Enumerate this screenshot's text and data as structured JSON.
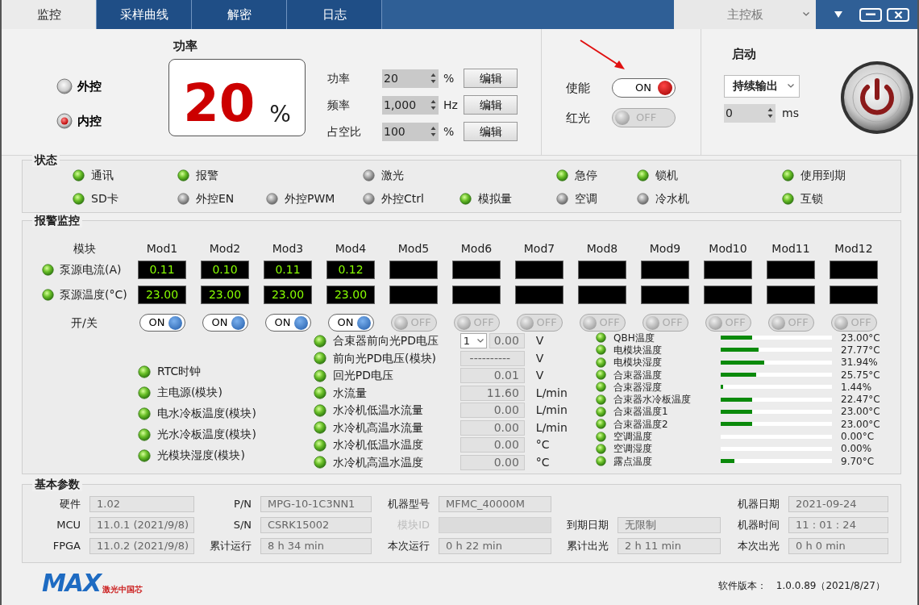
{
  "tabs": [
    {
      "label": "监控",
      "selected": true
    },
    {
      "label": "采样曲线",
      "selected": false
    },
    {
      "label": "解密",
      "selected": false
    },
    {
      "label": "日志",
      "selected": false
    }
  ],
  "board_select": {
    "value": "主控板"
  },
  "control_mode": [
    {
      "label": "外控",
      "selected": false
    },
    {
      "label": "内控",
      "selected": true
    }
  ],
  "power_display": {
    "title": "功率",
    "value": "20",
    "unit": "%"
  },
  "settings": [
    {
      "label": "功率",
      "value": "20",
      "unit": "%",
      "button": "编辑"
    },
    {
      "label": "频率",
      "value": "1,000",
      "unit": "Hz",
      "button": "编辑"
    },
    {
      "label": "占空比",
      "value": "100",
      "unit": "%",
      "button": "编辑"
    }
  ],
  "switches": [
    {
      "label": "使能",
      "on": true,
      "text": "ON"
    },
    {
      "label": "红光",
      "on": false,
      "text": "OFF"
    }
  ],
  "start": {
    "title": "启动",
    "mode": "持续输出",
    "delay": "0",
    "delay_unit": "ms"
  },
  "status": {
    "title": "状态",
    "rows": [
      [
        {
          "label": "通讯",
          "on": true
        },
        {
          "label": "报警",
          "on": true
        },
        "",
        {
          "label": "激光",
          "on": false
        },
        "",
        {
          "label": "急停",
          "on": true
        },
        {
          "label": "锁机",
          "on": true
        },
        "",
        {
          "label": "使用到期",
          "on": true
        }
      ],
      [
        {
          "label": "SD卡",
          "on": true
        },
        {
          "label": "外控EN",
          "on": false
        },
        {
          "label": "外控PWM",
          "on": false
        },
        {
          "label": "外控Ctrl",
          "on": false
        },
        {
          "label": "模拟量",
          "on": true
        },
        {
          "label": "空调",
          "on": false
        },
        {
          "label": "冷水机",
          "on": false
        },
        "",
        {
          "label": "互锁",
          "on": true
        }
      ]
    ]
  },
  "alarm": {
    "title": "报警监控",
    "module_header": "模块",
    "row_labels": [
      {
        "label": "泵源电流(A)",
        "on": true
      },
      {
        "label": "泵源温度(°C)",
        "on": true
      }
    ],
    "switch_label": "开/关",
    "modules": [
      {
        "name": "Mod1",
        "current": "0.11",
        "temp": "23.00",
        "on": true,
        "switch_text": "ON"
      },
      {
        "name": "Mod2",
        "current": "0.10",
        "temp": "23.00",
        "on": true,
        "switch_text": "ON"
      },
      {
        "name": "Mod3",
        "current": "0.11",
        "temp": "23.00",
        "on": true,
        "switch_text": "ON"
      },
      {
        "name": "Mod4",
        "current": "0.12",
        "temp": "23.00",
        "on": true,
        "switch_text": "ON"
      },
      {
        "name": "Mod5",
        "on": false,
        "switch_text": "OFF"
      },
      {
        "name": "Mod6",
        "on": false,
        "switch_text": "OFF"
      },
      {
        "name": "Mod7",
        "on": false,
        "switch_text": "OFF"
      },
      {
        "name": "Mod8",
        "on": false,
        "switch_text": "OFF"
      },
      {
        "name": "Mod9",
        "on": false,
        "switch_text": "OFF"
      },
      {
        "name": "Mod10",
        "on": false,
        "switch_text": "OFF"
      },
      {
        "name": "Mod11",
        "on": false,
        "switch_text": "OFF"
      },
      {
        "name": "Mod12",
        "on": false,
        "switch_text": "OFF"
      }
    ],
    "indicators": [
      {
        "label": "RTC时钟",
        "on": true
      },
      {
        "label": "主电源(模块)",
        "on": true
      },
      {
        "label": "电水冷板温度(模块)",
        "on": true
      },
      {
        "label": "光水冷板温度(模块)",
        "on": true
      },
      {
        "label": "光模块湿度(模块)",
        "on": true
      }
    ],
    "readings": [
      {
        "kind": "select",
        "label": "合束器前向光PD电压",
        "channel": "1",
        "value": "0.00",
        "unit": "V",
        "on": true
      },
      {
        "kind": "plain",
        "label": "前向光PD电压(模块)",
        "value": "----------",
        "unit": "V",
        "on": true
      },
      {
        "kind": "plain",
        "label": "回光PD电压",
        "value": "0.01",
        "unit": "V",
        "on": true
      },
      {
        "kind": "plain",
        "label": "水流量",
        "value": "11.60",
        "unit": "L/min",
        "on": true
      },
      {
        "kind": "plain",
        "label": "水冷机低温水流量",
        "value": "0.00",
        "unit": "L/min",
        "on": true
      },
      {
        "kind": "plain",
        "label": "水冷机高温水流量",
        "value": "0.00",
        "unit": "L/min",
        "on": true
      },
      {
        "kind": "plain",
        "label": "水冷机低温水温度",
        "value": "0.00",
        "unit": "°C",
        "on": true
      },
      {
        "kind": "plain",
        "label": "水冷机高温水温度",
        "value": "0.00",
        "unit": "°C",
        "on": true
      }
    ],
    "gauges": [
      {
        "label": "QBH温度",
        "level": 0.28,
        "reading": "23.00°C",
        "on": true
      },
      {
        "label": "电模块温度",
        "level": 0.34,
        "reading": "27.77°C",
        "on": true
      },
      {
        "label": "电模块湿度",
        "level": 0.39,
        "reading": "31.94%",
        "on": true
      },
      {
        "label": "合束器温度",
        "level": 0.32,
        "reading": "25.75°C",
        "on": true
      },
      {
        "label": "合束器湿度",
        "level": 0.02,
        "reading": "1.44%",
        "on": true
      },
      {
        "label": "合束器水冷板温度",
        "level": 0.28,
        "reading": "22.47°C",
        "on": true
      },
      {
        "label": "合束器温度1",
        "level": 0.28,
        "reading": "23.00°C",
        "on": true
      },
      {
        "label": "合束器温度2",
        "level": 0.28,
        "reading": "23.00°C",
        "on": true
      },
      {
        "label": "空调温度",
        "reading": "0.00°C",
        "on": true
      },
      {
        "label": "空调湿度",
        "reading": "0.00%",
        "on": true
      },
      {
        "label": "露点温度",
        "level": 0.12,
        "reading": "9.70°C",
        "on": true
      }
    ]
  },
  "params": {
    "title": "基本参数",
    "rows": [
      [
        {
          "label": "硬件",
          "value": "1.02",
          "disabled": false
        },
        {
          "label": "P/N",
          "value": "MPG-10-1C3NN1",
          "disabled": false
        },
        {
          "label": "机器型号",
          "value": "MFMC_40000M",
          "disabled": false
        },
        "",
        {
          "label": "机器日期",
          "value": "2021-09-24",
          "disabled": false
        }
      ],
      [
        {
          "label": "MCU",
          "value": "11.0.1 (2021/9/8)",
          "disabled": false
        },
        {
          "label": "S/N",
          "value": "CSRK15002",
          "disabled": false
        },
        {
          "label": "模块ID",
          "disabled": true
        },
        {
          "label": "到期日期",
          "value": "无限制",
          "disabled": false
        },
        {
          "label": "机器时间",
          "value": "11 : 01 : 24",
          "disabled": false
        }
      ],
      [
        {
          "label": "FPGA",
          "value": "11.0.2 (2021/9/8)",
          "disabled": false
        },
        {
          "label": "累计运行",
          "value": "8 h 34 min",
          "disabled": false
        },
        {
          "label": "本次运行",
          "value": "0 h 22 min",
          "disabled": false
        },
        {
          "label": "累计出光",
          "value": "2 h 11 min",
          "disabled": false
        },
        {
          "label": "本次出光",
          "value": "0 h 0 min",
          "disabled": false
        }
      ]
    ]
  },
  "footer": {
    "logo": "MAX",
    "logo_sub": "激光中国芯",
    "version_label": "软件版本：",
    "version": "1.0.0.89（2021/8/27）"
  }
}
